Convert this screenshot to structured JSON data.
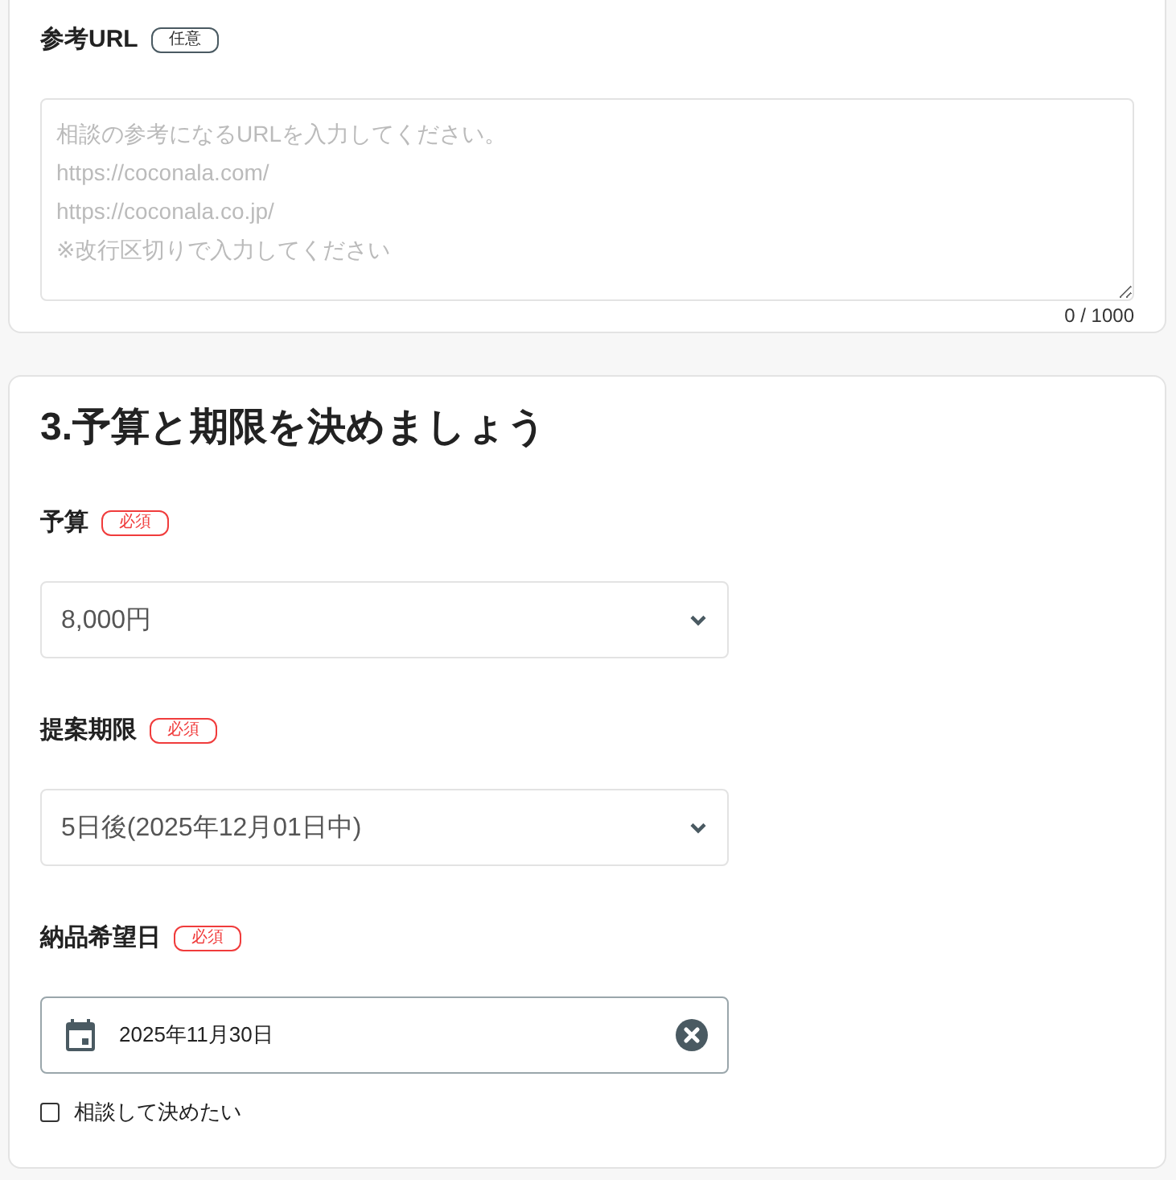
{
  "sections": [
    {
      "fields": [
        {
          "kind": "textarea",
          "label": "参考URL",
          "badge": {
            "text": "任意",
            "kind": "optional"
          },
          "placeholder": "相談の参考になるURLを入力してください。\nhttps://coconala.com/\nhttps://coconala.co.jp/\n※改行区切りで入力してください",
          "counter": "0 / 1000"
        }
      ]
    },
    {
      "heading": "3.予算と期限を決めましょう",
      "fields": [
        {
          "kind": "select",
          "label": "予算",
          "badge": {
            "text": "必須",
            "kind": "required"
          },
          "value": "8,000円"
        },
        {
          "kind": "select",
          "label": "提案期限",
          "badge": {
            "text": "必須",
            "kind": "required"
          },
          "value": "5日後(2025年12月01日中)"
        },
        {
          "kind": "date",
          "label": "納品希望日",
          "badge": {
            "text": "必須",
            "kind": "required"
          },
          "value": "2025年11月30日",
          "checkbox": {
            "label": "相談して決めたい",
            "checked": false
          }
        }
      ]
    }
  ]
}
